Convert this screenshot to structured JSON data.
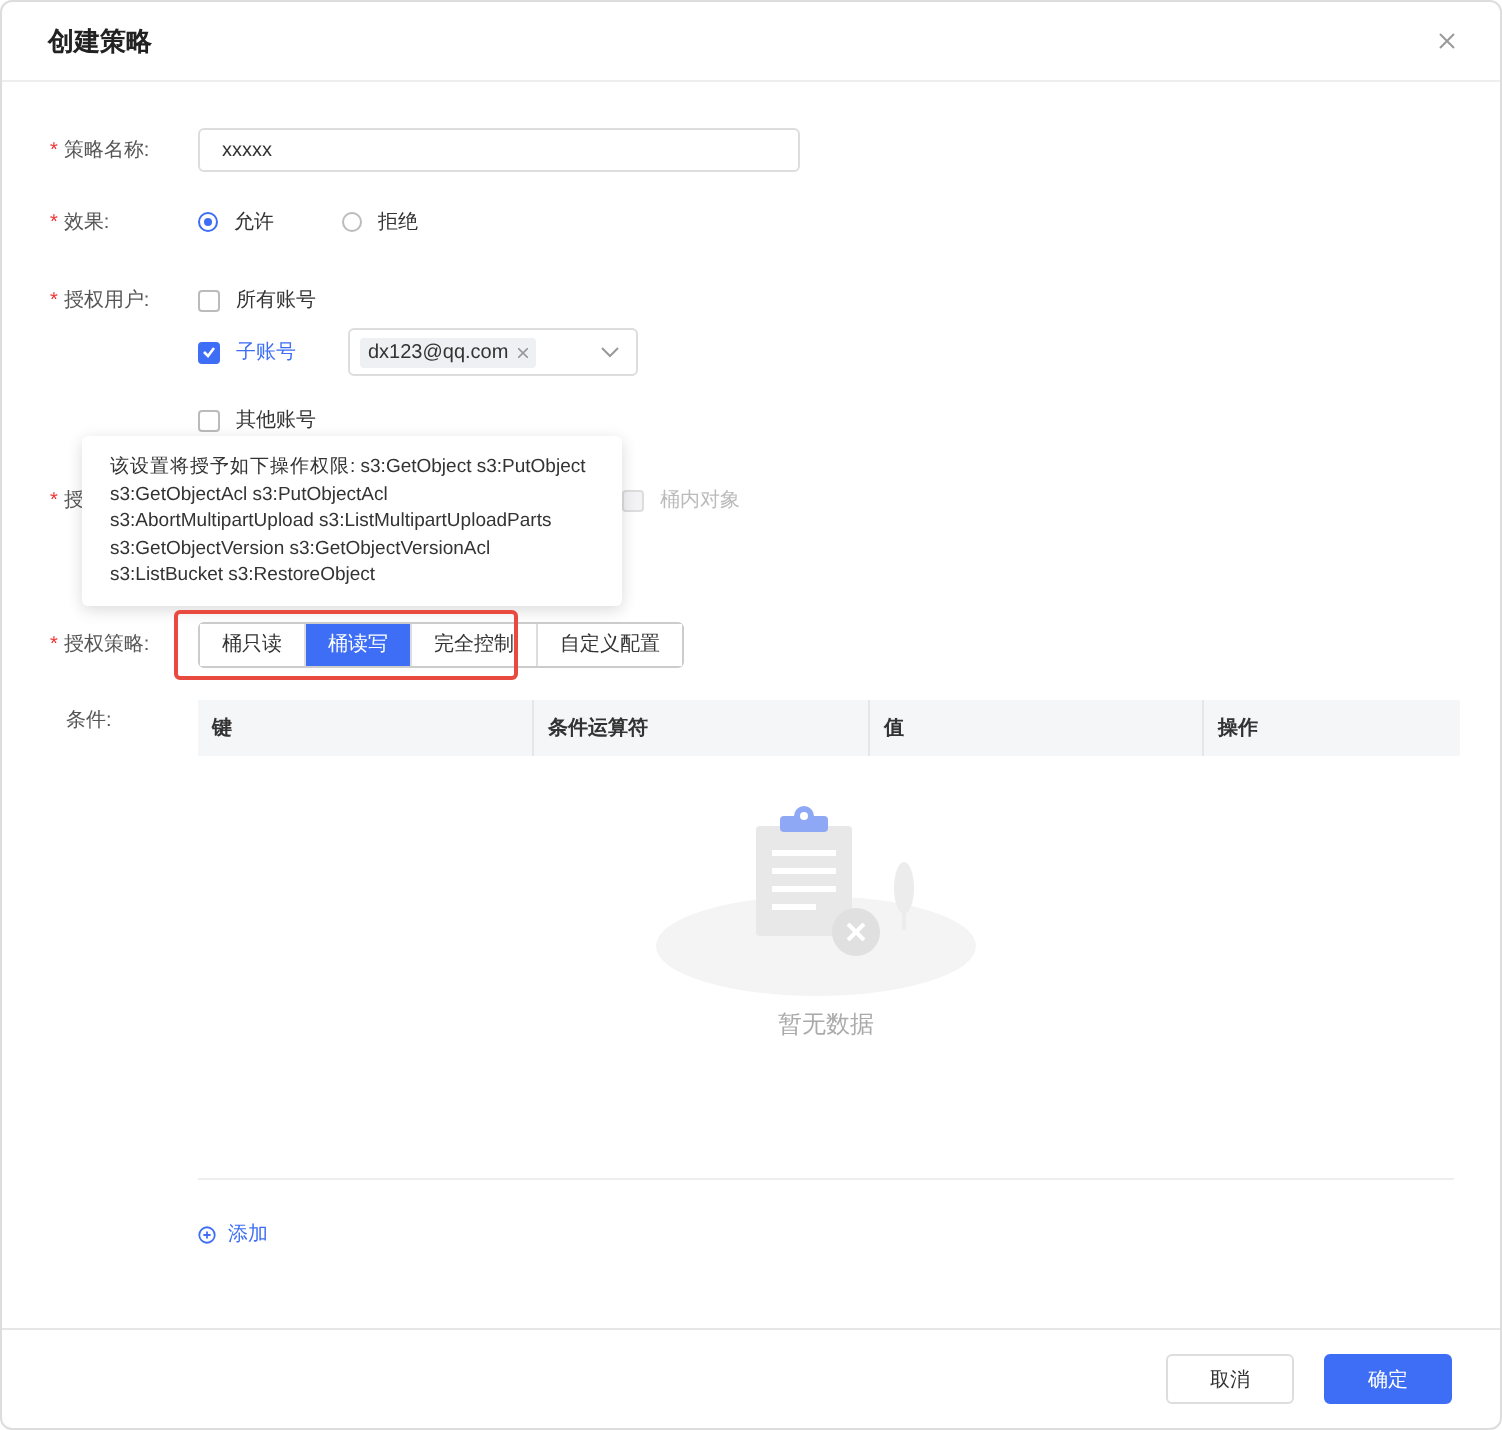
{
  "dialog": {
    "title": "创建策略"
  },
  "form": {
    "name": {
      "mark": "*",
      "label": "策略名称:",
      "value": "xxxxx"
    },
    "effect": {
      "mark": "*",
      "label": "效果:",
      "options": [
        {
          "label": "允许",
          "selected": true
        },
        {
          "label": "拒绝",
          "selected": false
        }
      ]
    },
    "users": {
      "mark": "*",
      "label": "授权用户:",
      "options": [
        {
          "label": "所有账号",
          "checked": false
        },
        {
          "label": "子账号",
          "checked": true,
          "tags": [
            "dx123@qq.com"
          ]
        },
        {
          "label": "其他账号",
          "checked": false
        }
      ]
    },
    "resources": {
      "mark": "*",
      "label": "授",
      "options": [
        {
          "label": "桶内对象",
          "checked": false,
          "disabled": true
        }
      ]
    },
    "policy": {
      "mark": "*",
      "label": "授权策略:",
      "options": [
        {
          "label": "桶只读",
          "selected": false
        },
        {
          "label": "桶读写",
          "selected": true
        },
        {
          "label": "完全控制",
          "selected": false
        },
        {
          "label": "自定义配置",
          "selected": false
        }
      ]
    },
    "conditions": {
      "label": "条件:",
      "columns": [
        "键",
        "条件运算符",
        "值",
        "操作"
      ],
      "empty_text": "暂无数据",
      "add_link": "添加"
    }
  },
  "tooltip": {
    "lines": [
      "该设置将授予如下操作权限: s3:GetObject s3:PutObject",
      "s3:GetObjectAcl s3:PutObjectAcl",
      "s3:AbortMultipartUpload s3:ListMultipartUploadParts",
      "s3:GetObjectVersion s3:GetObjectVersionAcl",
      "s3:ListBucket s3:RestoreObject"
    ]
  },
  "footer": {
    "buttons": [
      {
        "label": "取消",
        "kind": "secondary"
      },
      {
        "label": "确定",
        "kind": "primary"
      }
    ]
  }
}
